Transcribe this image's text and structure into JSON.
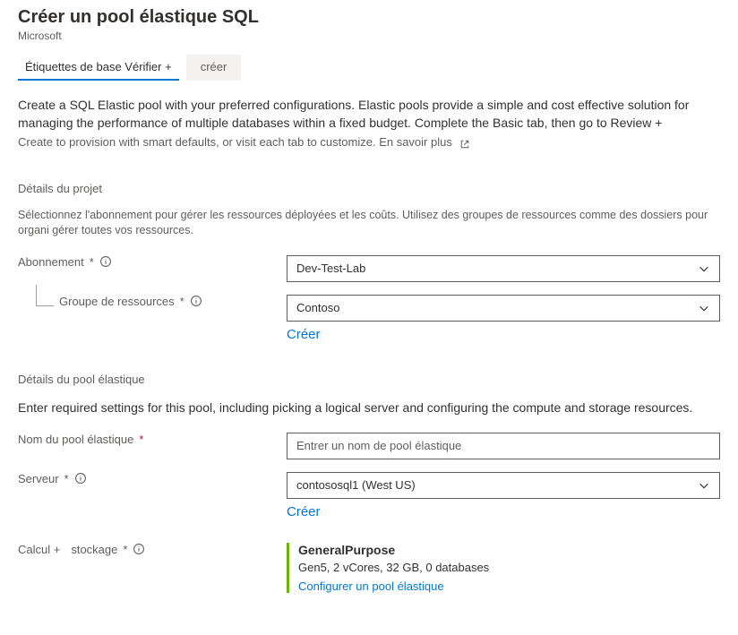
{
  "header": {
    "title": "Créer un pool élastique SQL",
    "subtitle": "Microsoft"
  },
  "tabs": {
    "basic": "Étiquettes de base Vérifier +",
    "create": "créer"
  },
  "intro": {
    "line1": "Create a SQL Elastic pool with your preferred configurations. Elastic pools provide a simple and cost effective solution for managing the performance of multiple databases within a fixed budget. Complete the Basic tab, then go to Review +",
    "line2": "Create to provision with smart defaults, or visit each tab to customize.",
    "learn_more": "En savoir plus"
  },
  "project": {
    "section_title": "Détails du projet",
    "help": "Sélectionnez l'abonnement pour gérer les ressources déployées et les coûts. Utilisez des groupes de ressources comme des dossiers pour organi gérer toutes vos ressources.",
    "subscription_label": "Abonnement",
    "subscription_value": "Dev-Test-Lab",
    "rg_label": "Groupe de ressources",
    "rg_value": "Contoso",
    "create_new": "Créer"
  },
  "pool": {
    "section_title": "Détails du pool élastique",
    "desc": "Enter required settings for this pool, including picking a logical server and configuring the compute and storage resources.",
    "name_label": "Nom du pool élastique",
    "name_placeholder": "Entrer un nom de pool élastique",
    "server_label": "Serveur",
    "server_value": "contososql1 (West US)",
    "create_new": "Créer",
    "compute_label_a": "Calcul +",
    "compute_label_b": "stockage",
    "compute_title": "GeneralPurpose",
    "compute_detail": "Gen5, 2 vCores, 32 GB, 0 databases",
    "configure_link": "Configurer un pool élastique"
  }
}
